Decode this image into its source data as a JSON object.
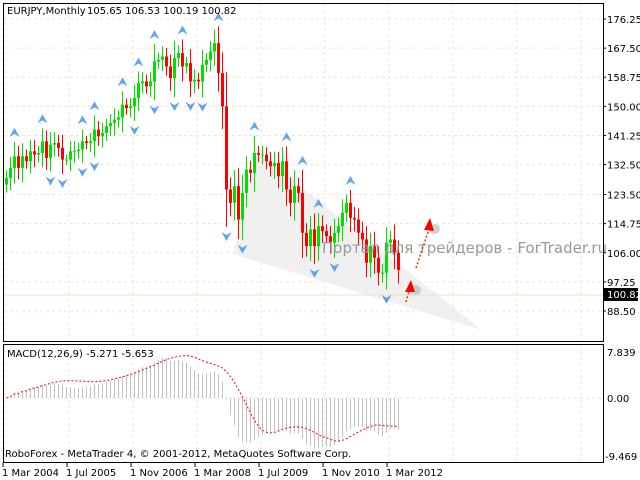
{
  "header": {
    "symbol": "EURJPY,Monthly",
    "ohlc": "105.65 106.53 100.19 100.82"
  },
  "macd": {
    "label": "MACD(12,26,9) -5.271 -5.653",
    "axis": [
      "7.839",
      "0.00",
      "-9.469"
    ],
    "range": [
      -9.469,
      7.839
    ]
  },
  "footer": "RoboForex - MetaTrader 4, © 2001-2012, MetaQuotes Software Corp.",
  "watermark": "Портал для трейдеров - ForTrader.ru",
  "current_price": "100.82",
  "colors": {
    "bull": "#00e000",
    "bear": "#ff0000",
    "grid": "#ecebc8",
    "fractal": "#3a8df0",
    "signal": "#ff0000",
    "hist": "#c0c0c0"
  },
  "chart_data": {
    "type": "candlestick",
    "title": "EURJPY,Monthly",
    "price_ticks": [
      "176.25",
      "167.50",
      "158.75",
      "150.00",
      "141.25",
      "132.50",
      "123.50",
      "114.75",
      "106.00",
      "97.25",
      "88.50"
    ],
    "ylim": [
      88.5,
      176.25
    ],
    "date_labels": [
      "1 Mar 2004",
      "1 Jul 2005",
      "1 Nov 2006",
      "1 Mar 2008",
      "1 Jul 2009",
      "1 Nov 2010",
      "1 Mar 2012"
    ],
    "date_label_bar_index": [
      0,
      16,
      32,
      48,
      64,
      80,
      96
    ],
    "close": [
      128.5,
      131.5,
      135,
      131.5,
      135,
      133.5,
      136.5,
      135.5,
      136,
      139.5,
      134.5,
      138.5,
      139,
      137.5,
      134,
      134,
      136.5,
      136.5,
      137,
      139.5,
      139,
      139.5,
      143,
      141,
      142,
      144,
      145,
      146,
      146.7,
      150.5,
      149.5,
      150,
      152.5,
      157,
      157.5,
      156,
      157.5,
      163.5,
      164,
      165,
      162,
      158.5,
      164.5,
      166,
      162,
      163,
      157.5,
      158,
      157.5,
      162.5,
      164,
      166.5,
      169,
      160,
      150,
      125,
      121,
      126,
      116,
      124,
      131,
      130,
      136,
      135.5,
      135.5,
      133.5,
      132,
      133,
      129,
      133.5,
      125,
      121,
      126,
      124,
      112,
      108,
      113,
      108,
      114,
      112.5,
      111,
      109,
      112,
      114,
      118,
      121,
      116.5,
      116,
      112,
      110,
      103,
      108,
      104.5,
      100,
      100,
      109,
      110,
      106,
      100.82
    ]
  }
}
